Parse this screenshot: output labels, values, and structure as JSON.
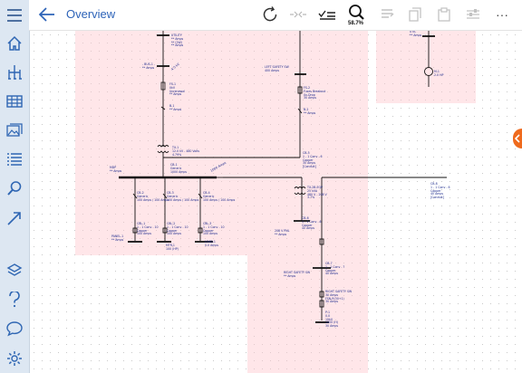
{
  "header": {
    "title": "Overview",
    "zoom_level": "58.7%"
  },
  "sidebar": {
    "items": [
      "menu",
      "home",
      "one-line",
      "table",
      "gallery",
      "list",
      "search",
      "route"
    ],
    "bottom_items": [
      "layers",
      "help",
      "comments",
      "settings"
    ]
  },
  "toolbar": {
    "items": [
      "undo",
      "connect",
      "check-list",
      "zoom",
      "notes",
      "copy",
      "paste",
      "properties",
      "more"
    ],
    "more_label": "···"
  },
  "diagram": {
    "utility_label": "UTILITY\n** Amps\n** (2W)\n** Amps",
    "bus1_label": "- BUS-1 -\n** Amps",
    "fs1_label": "FS-1\n0kV\nUnrenewal\n** Amps",
    "b1_label": "B-1\n** Amps",
    "tx1_label": "TX-1\n12.0 kV - 480 Volts\n4.79%",
    "cb1_label": "CB-1\nGeneric\n1000 Amps",
    "mdp_label": "MDP\n** Amps",
    "cb2_label": "CB-2\nGeneric\n100 Amps / 100 Amps",
    "cb3_label": "CB-3\nGeneric\n100 Amps / 100 Amps",
    "cb4_label": "CB-4\nGeneric\n100 Amps / 100 Amps",
    "cbl1_label": "CBL-1\n1 - 1 Conv - 10\nCopper\n100 Amps",
    "cbl2_label": "CBL-2\n1 - 1 Conv - 10\nCopper\n100 Amps",
    "cbl3_label": "CBL-3\n1 - 1 Conv - 10\nCopper\n100 Amps",
    "panel1_label": "PANEL-1\n** Amps",
    "mtr_label": "MTR-1\n100 (HP)",
    "load1_label": "LOAD-1\n0.0 Amps",
    "left_safety_label": "LEFT SAFETY SW\n400 Amps",
    "fs2_label": "FS-2\nFuses Breakout\n0x-Drop\n30 Amps",
    "b2_label": "B-2\n** Amps",
    "cb5_label": "CB-5\n1 - 1 Conv - 6\nCopper\n30 Amps\n[Conduit]",
    "tx2_label": "TX-2B-EQP\n25 kVA\n480 V - 208 V\n3.7%",
    "cb6_label": "CB-6\n1 - 1 Conv - 6\nCopper\n40 Amps",
    "panel2_label": "208 V PNL\n** Amps",
    "cb7_label": "CB-7\n1 - 1 Conv - ?\nCopper\n40 Amps",
    "right_safety_label": "RIGHT SAFETY SW\n** Amps",
    "right_safety2_label": "RIGHT SAFETY SW\n30 Amps\nFSN-R(30+1)\n30 Amps",
    "right_load_label": "P-1\n0.0\n15kV\n1000 (H)\n30 Amps",
    "cb8_label": "CB-8\n1 - 1 Conv - 6\nCopper\n40 Amps\n[Conduit]",
    "util2_label": "UTIL\n** Amps",
    "m1_label": "M-1\n2.0 HP",
    "wire_a": "1000 Amps",
    "wire_b": "4.0 kV"
  }
}
